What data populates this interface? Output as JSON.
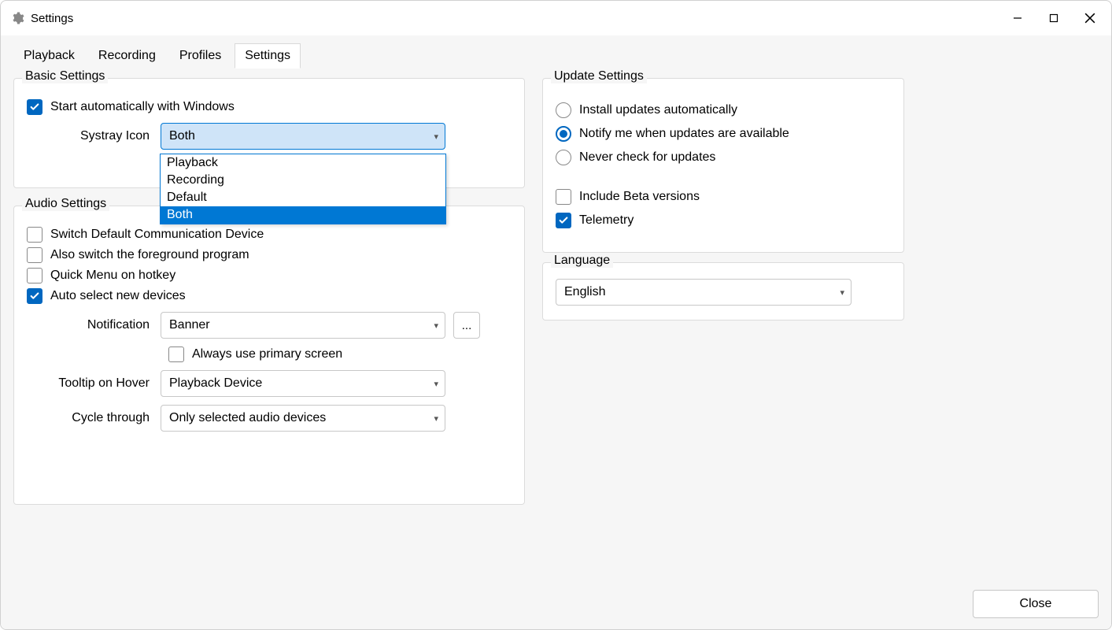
{
  "window": {
    "title": "Settings"
  },
  "tabs": [
    "Playback",
    "Recording",
    "Profiles",
    "Settings"
  ],
  "active_tab": "Settings",
  "basic": {
    "legend": "Basic Settings",
    "start_with_windows": "Start automatically with Windows",
    "systray_label": "Systray Icon",
    "systray_value": "Both",
    "systray_options": [
      "Playback",
      "Recording",
      "Default",
      "Both"
    ]
  },
  "audio": {
    "legend": "Audio Settings",
    "switch_default_comm": "Switch Default Communication Device",
    "also_switch_fg": "Also switch the foreground program",
    "quick_menu": "Quick Menu on hotkey",
    "auto_select_new": "Auto select new devices",
    "notification_label": "Notification",
    "notification_value": "Banner",
    "notification_more": "...",
    "always_primary": "Always use primary screen",
    "tooltip_label": "Tooltip on Hover",
    "tooltip_value": "Playback Device",
    "cycle_label": "Cycle through",
    "cycle_value": "Only selected audio devices"
  },
  "update": {
    "legend": "Update Settings",
    "opt_install_auto": "Install updates automatically",
    "opt_notify": "Notify me when updates are available",
    "opt_never": "Never check for updates",
    "include_beta": "Include Beta versions",
    "telemetry": "Telemetry"
  },
  "language": {
    "legend": "Language",
    "value": "English"
  },
  "footer": {
    "close": "Close"
  }
}
